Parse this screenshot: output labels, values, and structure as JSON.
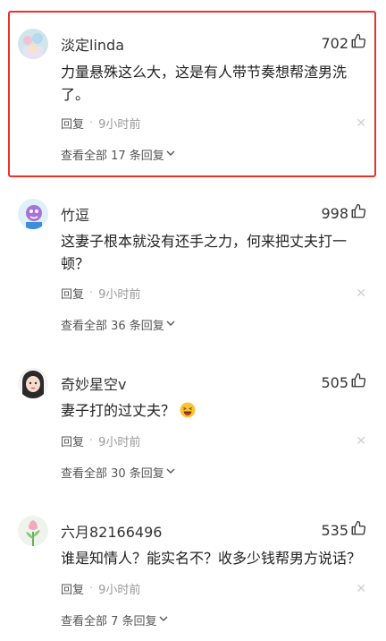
{
  "comments": [
    {
      "username": "淡定linda",
      "likes": "702",
      "text": "力量悬殊这么大，这是有人带节奏想帮渣男洗了。",
      "reply_label": "回复",
      "dot": "·",
      "time": "9小时前",
      "view_replies": "查看全部 17 条回复",
      "highlighted": true
    },
    {
      "username": "竹逗",
      "likes": "998",
      "text": "这妻子根本就没有还手之力，何来把丈夫打一顿？",
      "reply_label": "回复",
      "dot": "·",
      "time": "9小时前",
      "view_replies": "查看全部 36 条回复"
    },
    {
      "username": "奇妙星空v",
      "likes": "505",
      "text": "妻子打的过丈夫？",
      "emoji": "laughing-face-icon",
      "reply_label": "回复",
      "dot": "·",
      "time": "9小时前",
      "view_replies": "查看全部 30 条回复"
    },
    {
      "username": "六月82166496",
      "likes": "535",
      "text": "谁是知情人？能实名不？收多少钱帮男方说话？",
      "reply_label": "回复",
      "dot": "·",
      "time": "9小时前",
      "view_replies": "查看全部 7 条回复"
    }
  ],
  "icons": {
    "like": "thumbs-up-icon",
    "close": "close-icon",
    "expand": "chevron-down-icon"
  },
  "colors": {
    "highlight_border": "#e8322c",
    "meta_text": "#999999",
    "close_x": "#cfcfcf"
  }
}
